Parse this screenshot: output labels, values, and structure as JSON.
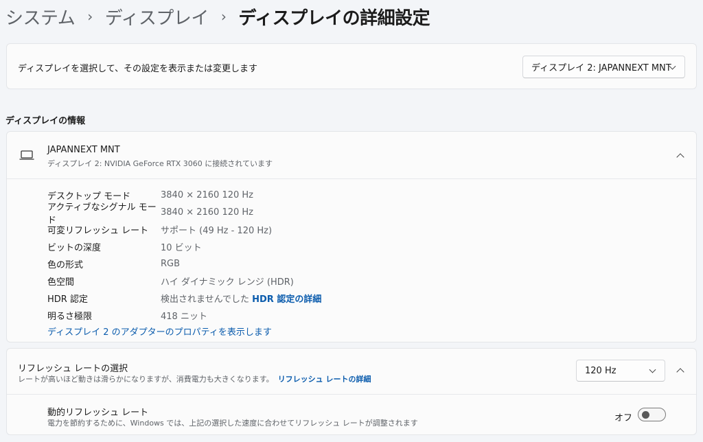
{
  "breadcrumb": {
    "items": [
      "システム",
      "ディスプレイ"
    ],
    "current": "ディスプレイの詳細設定",
    "separator": "›"
  },
  "display_select": {
    "description": "ディスプレイを選択して、その設定を表示または変更します",
    "selected": "ディスプレイ 2: JAPANNEXT MNT"
  },
  "section_title": "ディスプレイの情報",
  "monitor": {
    "icon": "laptop-icon",
    "name": "JAPANNEXT MNT",
    "subtitle": "ディスプレイ 2: NVIDIA GeForce RTX 3060 に接続されています",
    "rows": [
      {
        "label": "デスクトップ モード",
        "value": "3840 × 2160 120 Hz"
      },
      {
        "label": "アクティブなシグナル モード",
        "value": "3840 × 2160 120 Hz"
      },
      {
        "label": "可変リフレッシュ レート",
        "value": "サポート (49 Hz - 120 Hz)"
      },
      {
        "label": "ビットの深度",
        "value": "10 ビット"
      },
      {
        "label": "色の形式",
        "value": "RGB"
      },
      {
        "label": "色空間",
        "value": "ハイ ダイナミック レンジ (HDR)"
      },
      {
        "label": "HDR 認定",
        "value": "検出されませんでした",
        "link": "HDR 認定の詳細"
      },
      {
        "label": "明るさ極限",
        "value": "418 ニット"
      }
    ],
    "adapter_link": "ディスプレイ 2 のアダプターのプロパティを表示します"
  },
  "refresh": {
    "title": "リフレッシュ レートの選択",
    "subtitle": "レートが高いほど動きは滑らかになりますが、消費電力も大きくなります。",
    "link": "リフレッシュ レートの詳細",
    "selected": "120 Hz"
  },
  "dynamic_refresh": {
    "title": "動的リフレッシュ レート",
    "subtitle": "電力を節約するために、Windows では、上記の選択した速度に合わせてリフレッシュ レートが調整されます",
    "toggle_label": "オフ",
    "enabled": false
  },
  "colors": {
    "accent_link": "#0b5cad",
    "background": "#f3f5f8",
    "card": "#fbfbfb"
  }
}
